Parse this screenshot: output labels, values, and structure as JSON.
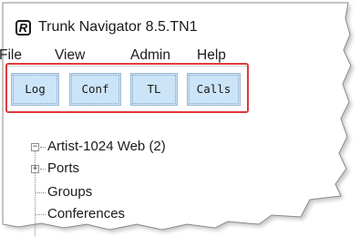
{
  "window": {
    "title": "Trunk Navigator 8.5.TN1",
    "icon": "app-logo-icon",
    "icon_letter": "R"
  },
  "menu": {
    "items": [
      {
        "label": "File"
      },
      {
        "label": "View"
      },
      {
        "label": "Admin"
      },
      {
        "label": "Help"
      }
    ]
  },
  "toolbar": {
    "highlight_color": "#e03a3a",
    "button_color": "#cce4f7",
    "buttons": [
      {
        "label": "Log"
      },
      {
        "label": "Conf"
      },
      {
        "label": "TL"
      },
      {
        "label": "Calls"
      }
    ]
  },
  "tree": {
    "root": {
      "label": "Artist-1024 Web (2)",
      "expander": "−"
    },
    "children": [
      {
        "label": "Ports",
        "expander": "+"
      },
      {
        "label": "Groups"
      },
      {
        "label": "Conferences"
      }
    ]
  }
}
